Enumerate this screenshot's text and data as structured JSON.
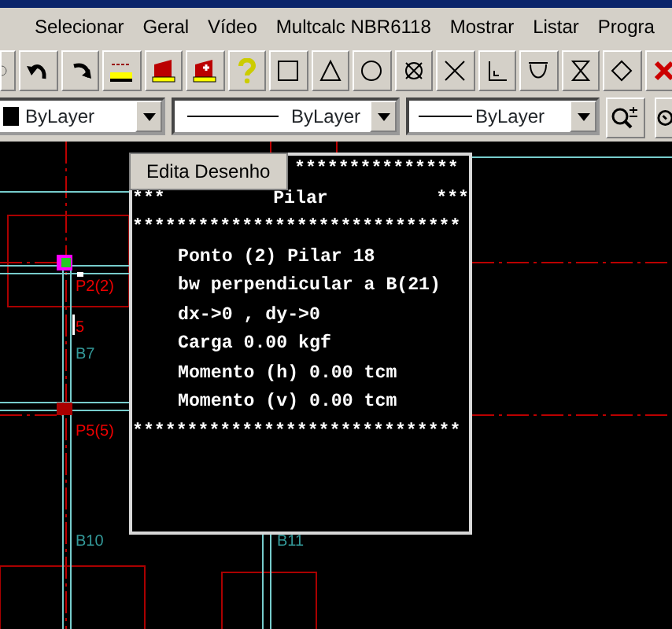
{
  "menu": [
    "Selecionar",
    "Geral",
    "Vídeo",
    "Multcalc NBR6118",
    "Mostrar",
    "Listar",
    "Progra"
  ],
  "layer_bar": {
    "color_setting": "ByLayer",
    "linetype": "ByLayer",
    "lineweight": "ByLayer"
  },
  "canvas_labels": [
    {
      "text": "P2(2)",
      "kind": "pillar"
    },
    {
      "text": "5",
      "kind": "pillar"
    },
    {
      "text": "B7",
      "kind": "beam"
    },
    {
      "text": "P5(5)",
      "kind": "pillar"
    },
    {
      "text": "B10",
      "kind": "beam"
    },
    {
      "text": "B11",
      "kind": "beam"
    }
  ],
  "tooltip": "Edita Desenho",
  "info_panel": {
    "top_rule": "***************",
    "title_left": "***",
    "title": "Pilar",
    "title_right": "***",
    "rule": "******************************",
    "lines": [
      "Ponto (2) Pilar 18",
      "bw perpendicular a B(21)",
      "dx->0 , dy->0",
      "Carga 0.00 kgf",
      "Momento (h) 0.00 tcm",
      "Momento (v) 0.00 tcm"
    ],
    "bottom_rule": "******************************"
  }
}
